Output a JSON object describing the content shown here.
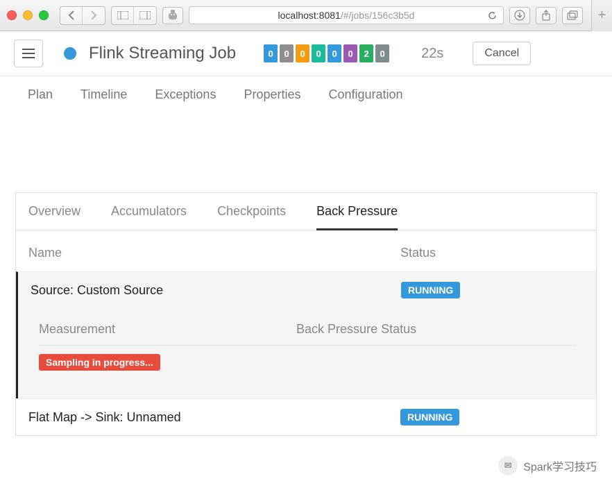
{
  "browser": {
    "url_host": "localhost:8081",
    "url_path": "/#/jobs/156c3b5d"
  },
  "header": {
    "job_title": "Flink Streaming Job",
    "counters": [
      {
        "value": "0",
        "color": "#3498db"
      },
      {
        "value": "0",
        "color": "#8e8e8e"
      },
      {
        "value": "0",
        "color": "#f39c12"
      },
      {
        "value": "0",
        "color": "#1abc9c"
      },
      {
        "value": "0",
        "color": "#3498db"
      },
      {
        "value": "0",
        "color": "#9b59b6"
      },
      {
        "value": "2",
        "color": "#27ae60"
      },
      {
        "value": "0",
        "color": "#7f8c8d"
      }
    ],
    "duration": "22s",
    "cancel_label": "Cancel"
  },
  "top_tabs": {
    "items": [
      "Plan",
      "Timeline",
      "Exceptions",
      "Properties",
      "Configuration"
    ]
  },
  "sub_tabs": {
    "items": [
      "Overview",
      "Accumulators",
      "Checkpoints",
      "Back Pressure"
    ],
    "active_index": 3
  },
  "columns": {
    "name": "Name",
    "status": "Status"
  },
  "operators": [
    {
      "name": "Source: Custom Source",
      "status_label": "RUNNING",
      "expanded": true,
      "inner": {
        "col1": "Measurement",
        "col2": "Back Pressure Status",
        "sampling_label": "Sampling in progress..."
      }
    },
    {
      "name": "Flat Map -> Sink: Unnamed",
      "status_label": "RUNNING",
      "expanded": false
    }
  ],
  "watermark": {
    "text": "Spark学习技巧"
  }
}
